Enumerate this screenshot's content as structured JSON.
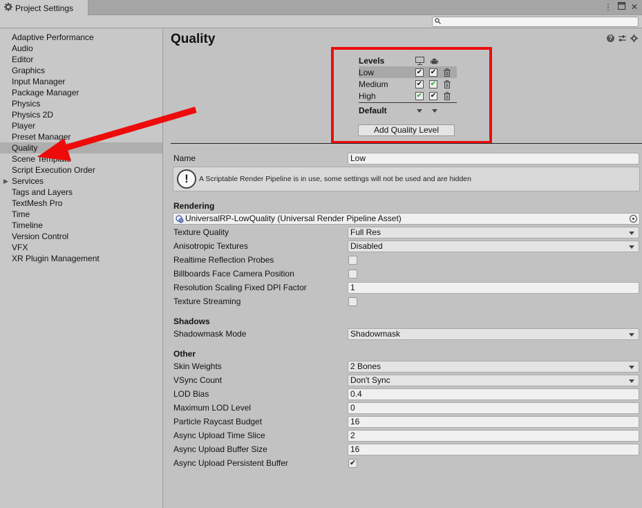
{
  "window": {
    "tab_title": "Project Settings",
    "menu_icon": "kebab-menu-icon",
    "maximize_icon": "maximize-icon",
    "close_icon": "close-icon"
  },
  "search": {
    "placeholder": "",
    "icon": "search-icon"
  },
  "sidebar": {
    "items": [
      {
        "label": "Adaptive Performance"
      },
      {
        "label": "Audio"
      },
      {
        "label": "Editor"
      },
      {
        "label": "Graphics"
      },
      {
        "label": "Input Manager"
      },
      {
        "label": "Package Manager"
      },
      {
        "label": "Physics"
      },
      {
        "label": "Physics 2D"
      },
      {
        "label": "Player"
      },
      {
        "label": "Preset Manager"
      },
      {
        "label": "Quality",
        "selected": true
      },
      {
        "label": "Scene Template"
      },
      {
        "label": "Script Execution Order"
      },
      {
        "label": "Services",
        "expandable": true
      },
      {
        "label": "Tags and Layers"
      },
      {
        "label": "TextMesh Pro"
      },
      {
        "label": "Time"
      },
      {
        "label": "Timeline"
      },
      {
        "label": "Version Control"
      },
      {
        "label": "VFX"
      },
      {
        "label": "XR Plugin Management"
      }
    ]
  },
  "main": {
    "title": "Quality",
    "levels": {
      "header": "Levels",
      "platforms": [
        "desktop-monitor-icon",
        "android-icon"
      ],
      "rows": [
        {
          "name": "Low",
          "desktop": true,
          "android": true,
          "desktop_default": false,
          "android_default": false,
          "selected": true
        },
        {
          "name": "Medium",
          "desktop": true,
          "android": true,
          "desktop_default": false,
          "android_default": true
        },
        {
          "name": "High",
          "desktop": true,
          "android": true,
          "desktop_default": true,
          "android_default": false
        }
      ],
      "default_label": "Default",
      "add_button": "Add Quality Level"
    },
    "name_label": "Name",
    "name_value": "Low",
    "help_message": "A Scriptable Render Pipeline is in use, some settings will not be used and are hidden",
    "rendering": {
      "header": "Rendering",
      "pipeline_asset": "UniversalRP-LowQuality (Universal Render Pipeline Asset)",
      "texture_quality_label": "Texture Quality",
      "texture_quality_value": "Full Res",
      "aniso_label": "Anisotropic Textures",
      "aniso_value": "Disabled",
      "reflection_label": "Realtime Reflection Probes",
      "billboards_label": "Billboards Face Camera Position",
      "dpi_label": "Resolution Scaling Fixed DPI Factor",
      "dpi_value": "1",
      "streaming_label": "Texture Streaming"
    },
    "shadows": {
      "header": "Shadows",
      "shadowmask_label": "Shadowmask Mode",
      "shadowmask_value": "Shadowmask"
    },
    "other": {
      "header": "Other",
      "skin_label": "Skin Weights",
      "skin_value": "2 Bones",
      "vsync_label": "VSync Count",
      "vsync_value": "Don't Sync",
      "lod_bias_label": "LOD Bias",
      "lod_bias_value": "0.4",
      "max_lod_label": "Maximum LOD Level",
      "max_lod_value": "0",
      "raycast_label": "Particle Raycast Budget",
      "raycast_value": "16",
      "timeslice_label": "Async Upload Time Slice",
      "timeslice_value": "2",
      "buffer_label": "Async Upload Buffer Size",
      "buffer_value": "16",
      "persistent_label": "Async Upload Persistent Buffer",
      "persistent_checked": true
    }
  },
  "annotation": {
    "highlight_color": "#ee0b0b",
    "arrow_color": "#ee0b0b"
  }
}
